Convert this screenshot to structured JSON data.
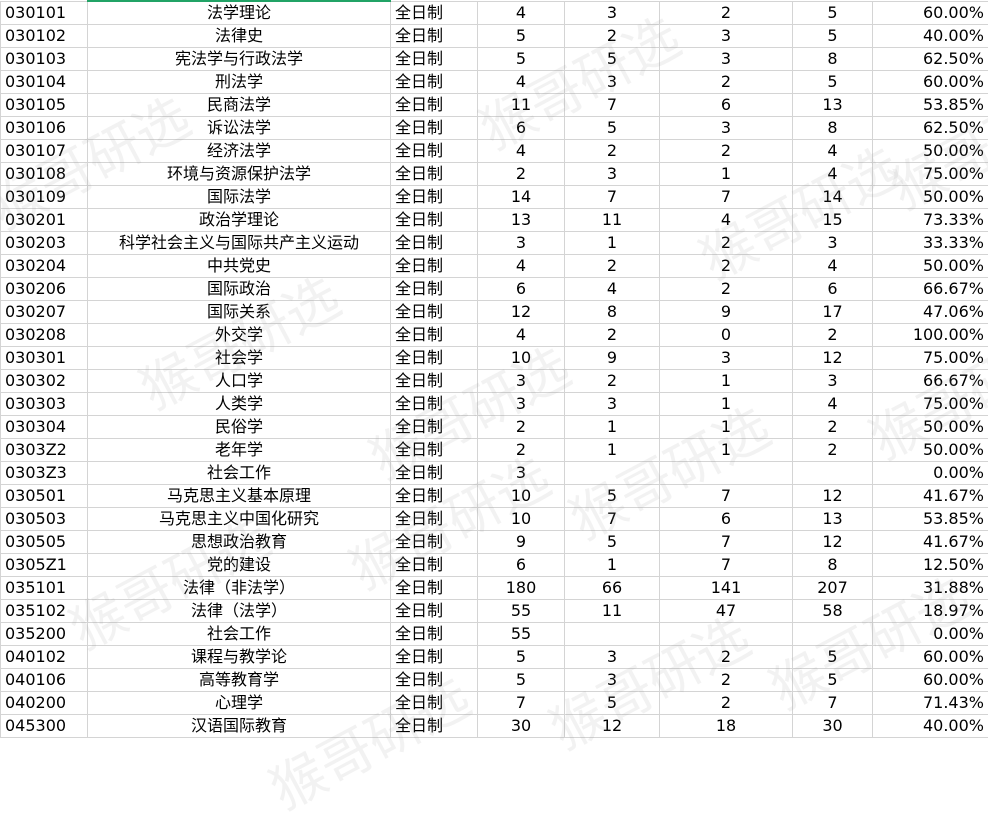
{
  "watermark": "猴哥研选",
  "rows": [
    [
      "030101",
      "法学理论",
      "全日制",
      "4",
      "3",
      "2",
      "5",
      "60.00%"
    ],
    [
      "030102",
      "法律史",
      "全日制",
      "5",
      "2",
      "3",
      "5",
      "40.00%"
    ],
    [
      "030103",
      "宪法学与行政法学",
      "全日制",
      "5",
      "5",
      "3",
      "8",
      "62.50%"
    ],
    [
      "030104",
      "刑法学",
      "全日制",
      "4",
      "3",
      "2",
      "5",
      "60.00%"
    ],
    [
      "030105",
      "民商法学",
      "全日制",
      "11",
      "7",
      "6",
      "13",
      "53.85%"
    ],
    [
      "030106",
      "诉讼法学",
      "全日制",
      "6",
      "5",
      "3",
      "8",
      "62.50%"
    ],
    [
      "030107",
      "经济法学",
      "全日制",
      "4",
      "2",
      "2",
      "4",
      "50.00%"
    ],
    [
      "030108",
      "环境与资源保护法学",
      "全日制",
      "2",
      "3",
      "1",
      "4",
      "75.00%"
    ],
    [
      "030109",
      "国际法学",
      "全日制",
      "14",
      "7",
      "7",
      "14",
      "50.00%"
    ],
    [
      "030201",
      "政治学理论",
      "全日制",
      "13",
      "11",
      "4",
      "15",
      "73.33%"
    ],
    [
      "030203",
      "科学社会主义与国际共产主义运动",
      "全日制",
      "3",
      "1",
      "2",
      "3",
      "33.33%"
    ],
    [
      "030204",
      "中共党史",
      "全日制",
      "4",
      "2",
      "2",
      "4",
      "50.00%"
    ],
    [
      "030206",
      "国际政治",
      "全日制",
      "6",
      "4",
      "2",
      "6",
      "66.67%"
    ],
    [
      "030207",
      "国际关系",
      "全日制",
      "12",
      "8",
      "9",
      "17",
      "47.06%"
    ],
    [
      "030208",
      "外交学",
      "全日制",
      "4",
      "2",
      "0",
      "2",
      "100.00%"
    ],
    [
      "030301",
      "社会学",
      "全日制",
      "10",
      "9",
      "3",
      "12",
      "75.00%"
    ],
    [
      "030302",
      "人口学",
      "全日制",
      "3",
      "2",
      "1",
      "3",
      "66.67%"
    ],
    [
      "030303",
      "人类学",
      "全日制",
      "3",
      "3",
      "1",
      "4",
      "75.00%"
    ],
    [
      "030304",
      "民俗学",
      "全日制",
      "2",
      "1",
      "1",
      "2",
      "50.00%"
    ],
    [
      "0303Z2",
      "老年学",
      "全日制",
      "2",
      "1",
      "1",
      "2",
      "50.00%"
    ],
    [
      "0303Z3",
      "社会工作",
      "全日制",
      "3",
      "",
      "",
      "",
      "0.00%"
    ],
    [
      "030501",
      "马克思主义基本原理",
      "全日制",
      "10",
      "5",
      "7",
      "12",
      "41.67%"
    ],
    [
      "030503",
      "马克思主义中国化研究",
      "全日制",
      "10",
      "7",
      "6",
      "13",
      "53.85%"
    ],
    [
      "030505",
      "思想政治教育",
      "全日制",
      "9",
      "5",
      "7",
      "12",
      "41.67%"
    ],
    [
      "0305Z1",
      "党的建设",
      "全日制",
      "6",
      "1",
      "7",
      "8",
      "12.50%"
    ],
    [
      "035101",
      "法律（非法学）",
      "全日制",
      "180",
      "66",
      "141",
      "207",
      "31.88%"
    ],
    [
      "035102",
      "法律（法学）",
      "全日制",
      "55",
      "11",
      "47",
      "58",
      "18.97%"
    ],
    [
      "035200",
      "社会工作",
      "全日制",
      "55",
      "",
      "",
      "",
      "0.00%"
    ],
    [
      "040102",
      "课程与教学论",
      "全日制",
      "5",
      "3",
      "2",
      "5",
      "60.00%"
    ],
    [
      "040106",
      "高等教育学",
      "全日制",
      "5",
      "3",
      "2",
      "5",
      "60.00%"
    ],
    [
      "040200",
      "心理学",
      "全日制",
      "7",
      "5",
      "2",
      "7",
      "71.43%"
    ],
    [
      "045300",
      "汉语国际教育",
      "全日制",
      "30",
      "12",
      "18",
      "30",
      "40.00%"
    ]
  ]
}
